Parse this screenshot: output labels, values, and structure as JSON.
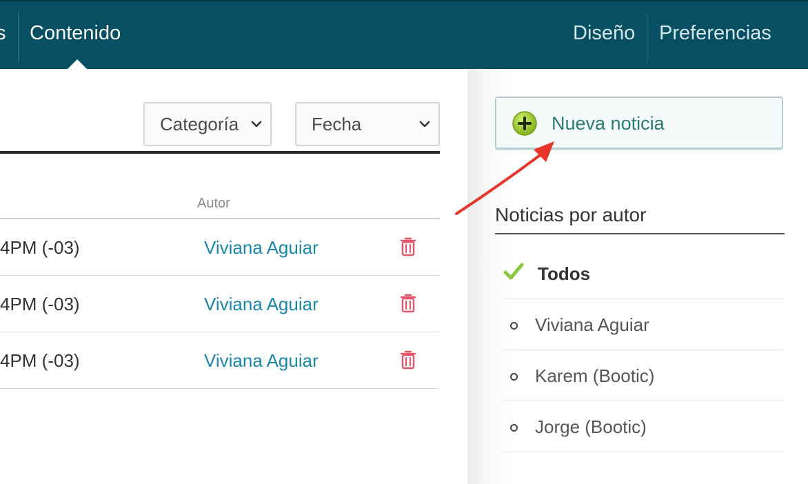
{
  "nav": {
    "partial_left": "s",
    "active": "Contenido",
    "right_items": [
      "Diseño",
      "Preferencias"
    ]
  },
  "filters": {
    "category": "Categoría",
    "date": "Fecha"
  },
  "table": {
    "header_author": "Autor",
    "rows": [
      {
        "date": "4PM (-03)",
        "author": "Viviana Aguiar"
      },
      {
        "date": "4PM (-03)",
        "author": "Viviana Aguiar"
      },
      {
        "date": "4PM (-03)",
        "author": "Viviana Aguiar"
      }
    ]
  },
  "sidebar": {
    "new_button": "Nueva noticia",
    "section_title": "Noticias por autor",
    "authors": [
      "Todos",
      "Viviana Aguiar",
      "Karem (Bootic)",
      "Jorge (Bootic)"
    ]
  },
  "colors": {
    "nav_bg": "#074f62",
    "link": "#1a86a8",
    "button_text": "#2b7d6a",
    "trash": "#e8546a",
    "arrow": "#e8352a"
  }
}
